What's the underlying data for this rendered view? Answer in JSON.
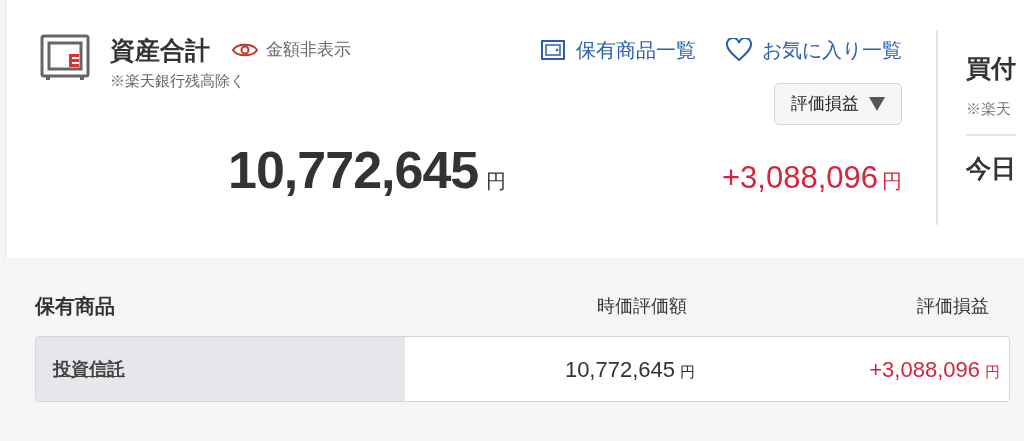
{
  "summary": {
    "title": "資産合計",
    "hide_toggle": "金額非表示",
    "note": "※楽天銀行残高除く",
    "links": [
      {
        "kind": "list",
        "label": "保有商品一覧"
      },
      {
        "kind": "favorite",
        "label": "お気に入り一覧"
      }
    ],
    "dropdown": "評価損益",
    "total": "10,772,645",
    "total_unit": "円",
    "gain": "+3,088,096",
    "gain_unit": "円"
  },
  "side_panel": {
    "title": "買付",
    "note": "※楽天",
    "row_label": "今日"
  },
  "holdings": {
    "title": "保有商品",
    "columns": [
      "時価評価額",
      "評価損益"
    ],
    "rows": [
      {
        "name": "投資信託",
        "value": "10,772,645",
        "value_unit": "円",
        "gain": "+3,088,096",
        "gain_unit": "円"
      }
    ]
  }
}
